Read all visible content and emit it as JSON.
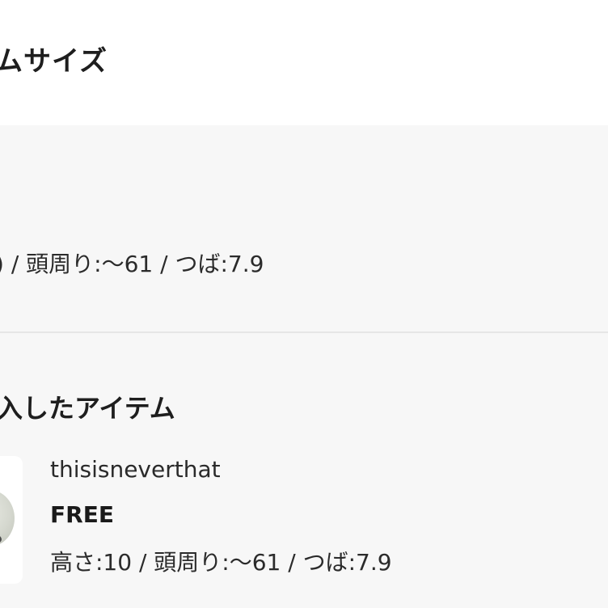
{
  "header": {
    "title": "ムサイズ"
  },
  "size_info": {
    "measurements": ") / 頭周り:〜61 / つば:7.9"
  },
  "purchased_items": {
    "title": "入したアイテム",
    "items": [
      {
        "brand": "thisisneverthat",
        "size": "FREE",
        "measurements": "高さ:10 / 頭周り:〜61 / つば:7.9"
      }
    ]
  }
}
